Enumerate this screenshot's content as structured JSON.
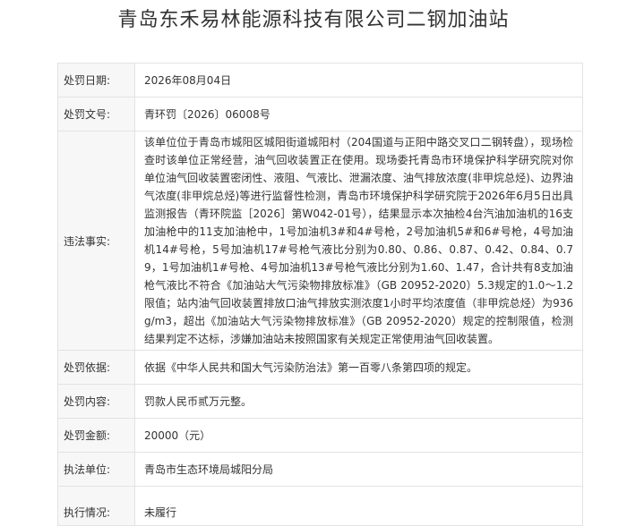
{
  "page": {
    "title": "青岛东禾易林能源科技有限公司二钢加油站"
  },
  "record": {
    "rows": [
      {
        "label": "处罚日期:",
        "value": "2026年08月04日"
      },
      {
        "label": "处罚文号:",
        "value": "青环罚〔2026〕06008号"
      },
      {
        "label": "违法事实:",
        "value": "该单位位于青岛市城阳区城阳街道城阳村（204国道与正阳中路交叉口二钢转盘），现场检查时该单位正常经营，油气回收装置正在使用。现场委托青岛市环境保护科学研究院对你单位油气回收装置密闭性、液阻、气液比、泄漏浓度、油气排放浓度(非甲烷总烃)、边界油气浓度(非甲烷总烃)等进行监督性检测，青岛市环境保护科学研究院于2026年6月5日出具监测报告（青环院监［2026］第W042-01号），结果显示本次抽检4台汽油加油机的16支加油枪中的11支加油枪中，1号加油机3#和4#号枪，2号加油机5#和6#号枪，4号加油机14#号枪，5号加油机17#号枪气液比分别为0.80、0.86、0.87、0.42、0.84、0.79，1号加油机1#号枪、4号加油机13#号枪气液比分别为1.60、1.47，合计共有8支加油枪气液比不符合《加油站大气污染物排放标准》（GB 20952-2020）5.3规定的1.0～1.2限值；站内油气回收装置排放口油气排放实测浓度1小时平均浓度值（非甲烷总烃）为936g/m3，超出《加油站大气污染物排放标准》（GB 20952-2020）规定的控制限值，检测结果判定不达标，涉嫌加油站未按照国家有关规定正常使用油气回收装置。"
      },
      {
        "label": "处罚依据:",
        "value": "依据《中华人民共和国大气污染防治法》第一百零八条第四项的规定。"
      },
      {
        "label": "处罚内容:",
        "value": "罚款人民币贰万元整。"
      },
      {
        "label": "处罚金额:",
        "value": "20000（元）"
      },
      {
        "label": "执法单位:",
        "value": "青岛市生态环境局城阳分局"
      },
      {
        "label": "执行情况:",
        "value": "未履行"
      }
    ]
  }
}
